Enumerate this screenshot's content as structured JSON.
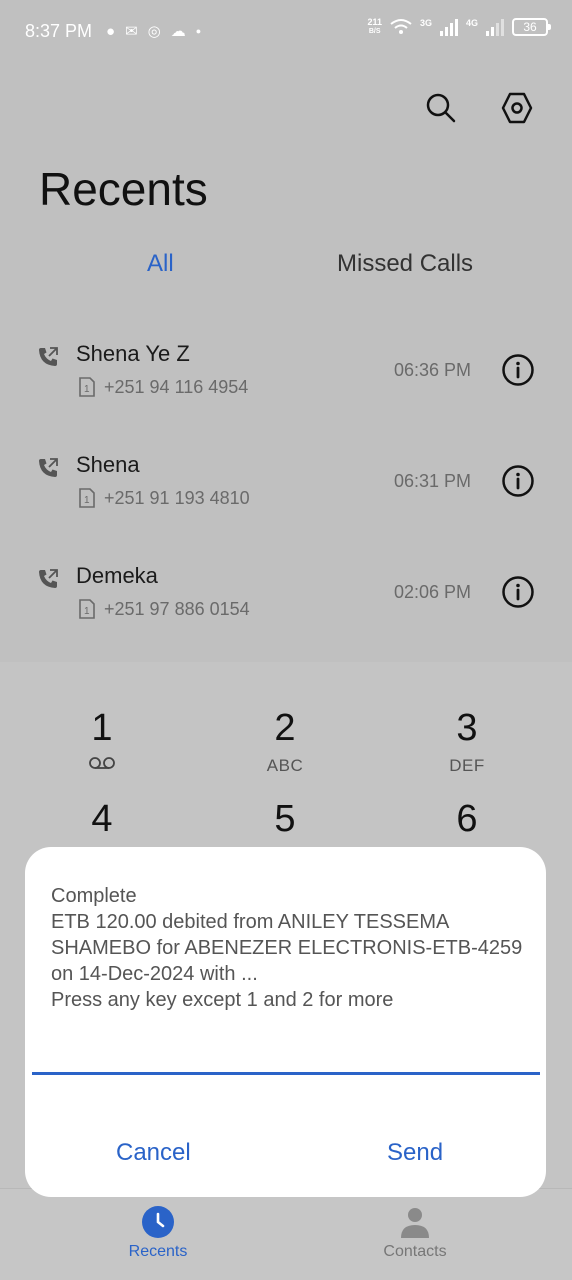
{
  "status_bar": {
    "time": "8:37 PM",
    "net_speed_value": "211",
    "net_speed_unit": "B/S",
    "network_1": "3G",
    "network_2": "4G",
    "battery": "36"
  },
  "header": {
    "title": "Recents"
  },
  "tabs": [
    {
      "label": "All",
      "active": true
    },
    {
      "label": "Missed Calls",
      "active": false
    }
  ],
  "calls": [
    {
      "name": "Shena Ye Z",
      "sim": "1",
      "number": "+251 94 116 4954",
      "time": "06:36 PM"
    },
    {
      "name": "Shena",
      "sim": "1",
      "number": "+251 91 193 4810",
      "time": "06:31 PM"
    },
    {
      "name": "Demeka",
      "sim": "1",
      "number": "+251 97 886 0154",
      "time": "02:06 PM"
    }
  ],
  "keypad": [
    {
      "digit": "1",
      "letters": ""
    },
    {
      "digit": "2",
      "letters": "ABC"
    },
    {
      "digit": "3",
      "letters": "DEF"
    },
    {
      "digit": "4",
      "letters": ""
    },
    {
      "digit": "5",
      "letters": ""
    },
    {
      "digit": "6",
      "letters": ""
    }
  ],
  "dialog": {
    "message": "Complete\nETB 120.00 debited from ANILEY TESSEMA SHAMEBO for ABENEZER ELECTRONIS-ETB-4259 on 14-Dec-2024 with ...\nPress any key except 1 and 2 for more",
    "input_value": "",
    "cancel_label": "Cancel",
    "send_label": "Send"
  },
  "bottom_nav": [
    {
      "label": "Recents",
      "active": true
    },
    {
      "label": "Contacts",
      "active": false
    }
  ],
  "colors": {
    "accent": "#2a63c8",
    "dim_background": "#c0c0c0",
    "dialog": "#ffffff"
  }
}
